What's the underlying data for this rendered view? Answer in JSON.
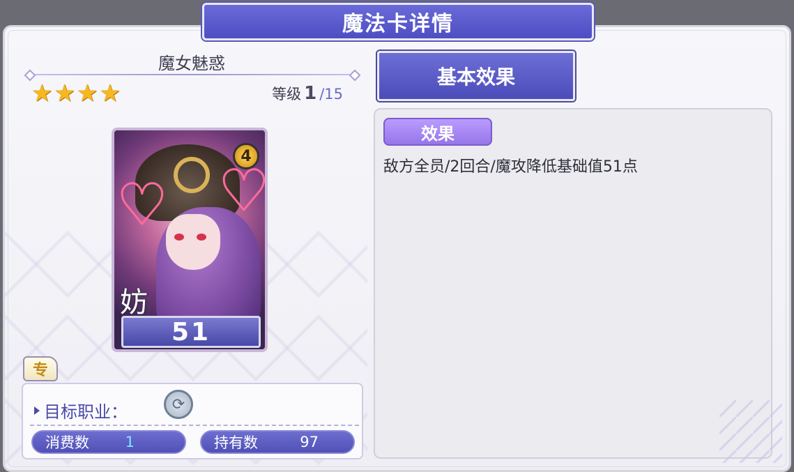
{
  "header": {
    "title": "魔法卡详情"
  },
  "card": {
    "name": "魔女魅惑",
    "stars": 4,
    "star_glyph": "★",
    "level_label": "等级",
    "level_current": "1",
    "level_max": "/15",
    "cost_badge": "4",
    "type_kanji": "妨",
    "value": "51",
    "exclusive_label": "专"
  },
  "info": {
    "target_label": "目标职业：",
    "job_icon": "job-class-icon",
    "consume_label": "消费数",
    "consume_value": "1",
    "hold_label": "持有数",
    "hold_value": "97"
  },
  "tabs": [
    {
      "label": "基本效果"
    }
  ],
  "effect": {
    "tag": "效果",
    "description": "敌方全员/2回合/魔攻降低基础值51点"
  },
  "colors": {
    "accent": "#5656c8",
    "effect_tag": "#a888f4",
    "star": "#f6b81c",
    "consume_value": "#7fe6ff"
  }
}
